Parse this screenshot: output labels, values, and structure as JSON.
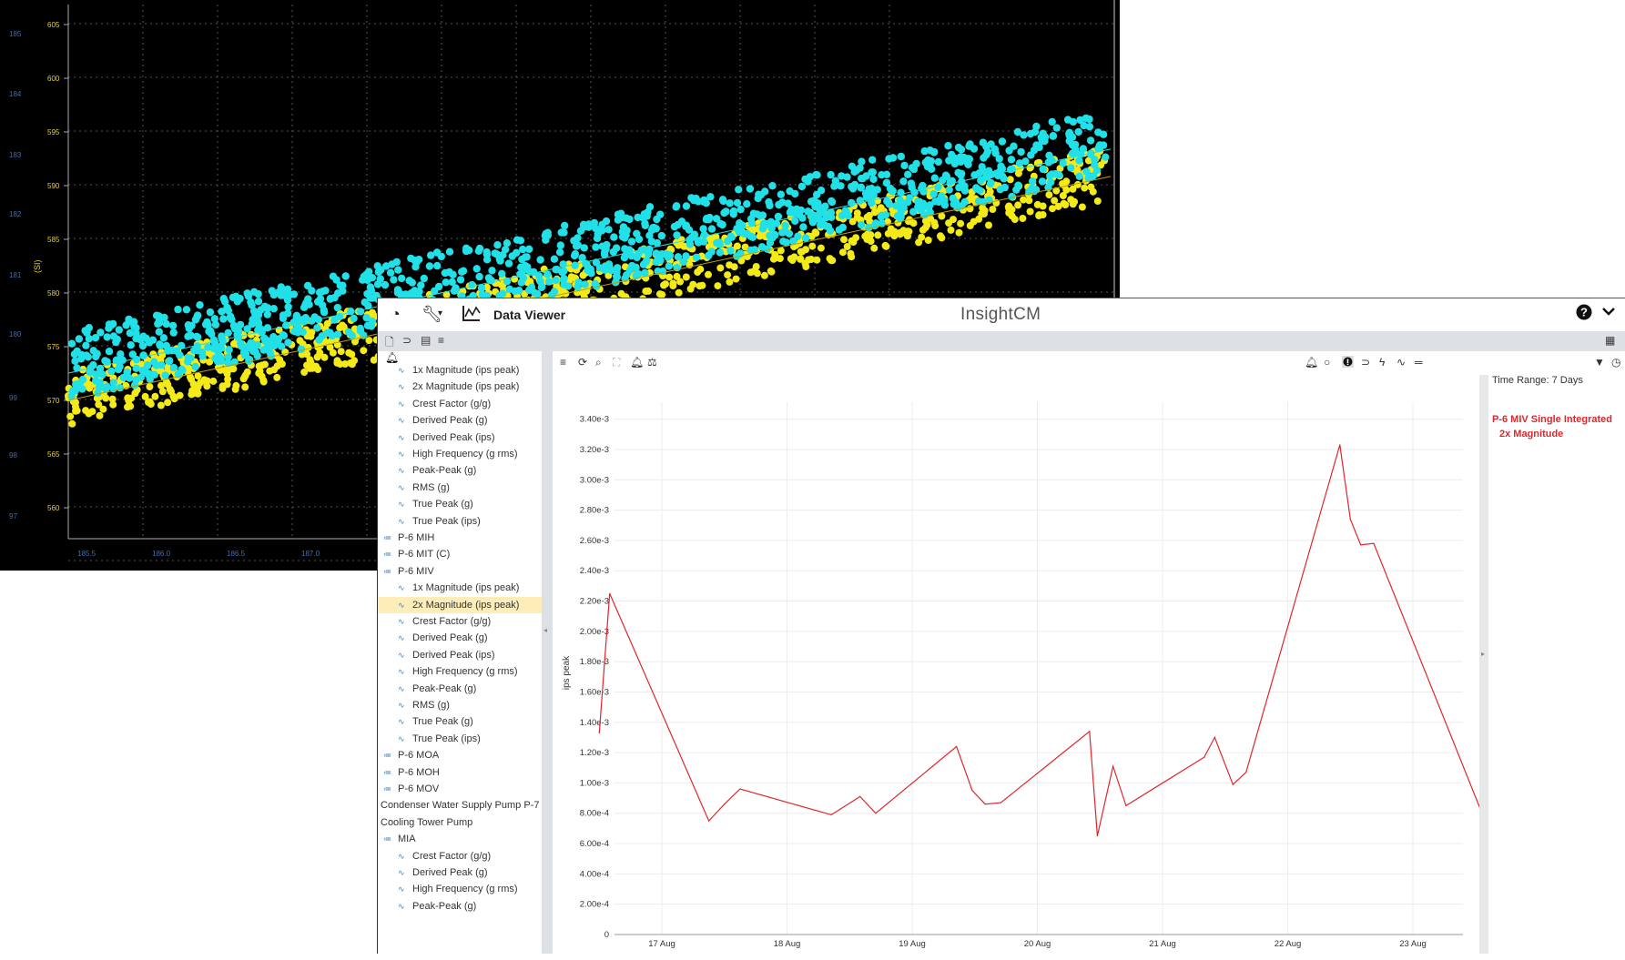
{
  "scatter_plot": {
    "y_left_ticks": [
      "185",
      "184",
      "183",
      "182",
      "181",
      "180",
      "99",
      "98",
      "97"
    ],
    "y_right_ticks": [
      "605",
      "600",
      "595",
      "590",
      "585",
      "580",
      "575",
      "570",
      "565",
      "560"
    ],
    "y_axis_label": "(SI)",
    "x_ticks": [
      "185.5",
      "186.0",
      "186.5",
      "187.0"
    ],
    "colors": {
      "series_a": "#22e0e8",
      "series_b": "#f3ea18",
      "background": "#000000",
      "grid": "#555555"
    }
  },
  "topbar": {
    "dashboard_icon": "dashboard-icon",
    "tools_icon": "wrench-icon",
    "chart_icon": "chart-icon",
    "title": "Data Viewer",
    "brand": "InsightCM",
    "help_icon": "help-icon",
    "chevron_icon": "chevron-down-icon"
  },
  "tree": {
    "items": [
      {
        "label": "1x Magnitude (ips peak)",
        "level": 2,
        "icon": "wave-icon"
      },
      {
        "label": "2x Magnitude (ips peak)",
        "level": 2,
        "icon": "wave-icon"
      },
      {
        "label": "Crest Factor (g/g)",
        "level": 2,
        "icon": "wave-icon"
      },
      {
        "label": "Derived Peak (g)",
        "level": 2,
        "icon": "wave-icon"
      },
      {
        "label": "Derived Peak (ips)",
        "level": 2,
        "icon": "wave-icon"
      },
      {
        "label": "High Frequency (g rms)",
        "level": 2,
        "icon": "wave-icon"
      },
      {
        "label": "Peak-Peak (g)",
        "level": 2,
        "icon": "wave-icon"
      },
      {
        "label": "RMS (g)",
        "level": 2,
        "icon": "wave-icon"
      },
      {
        "label": "True Peak (g)",
        "level": 2,
        "icon": "wave-icon"
      },
      {
        "label": "True Peak (ips)",
        "level": 2,
        "icon": "wave-icon"
      },
      {
        "label": "P-6 MIH",
        "level": 1,
        "icon": "sensor-icon"
      },
      {
        "label": "P-6 MIT (C)",
        "level": 1,
        "icon": "sensor-icon"
      },
      {
        "label": "P-6 MIV",
        "level": 1,
        "icon": "sensor-icon"
      },
      {
        "label": "1x Magnitude (ips peak)",
        "level": 2,
        "icon": "wave-icon"
      },
      {
        "label": "2x Magnitude (ips peak)",
        "level": 2,
        "icon": "wave-icon",
        "selected": true
      },
      {
        "label": "Crest Factor (g/g)",
        "level": 2,
        "icon": "wave-icon"
      },
      {
        "label": "Derived Peak (g)",
        "level": 2,
        "icon": "wave-icon"
      },
      {
        "label": "Derived Peak (ips)",
        "level": 2,
        "icon": "wave-icon"
      },
      {
        "label": "High Frequency (g rms)",
        "level": 2,
        "icon": "wave-icon"
      },
      {
        "label": "Peak-Peak (g)",
        "level": 2,
        "icon": "wave-icon"
      },
      {
        "label": "RMS (g)",
        "level": 2,
        "icon": "wave-icon"
      },
      {
        "label": "True Peak (g)",
        "level": 2,
        "icon": "wave-icon"
      },
      {
        "label": "True Peak (ips)",
        "level": 2,
        "icon": "wave-icon"
      },
      {
        "label": "P-6 MOA",
        "level": 1,
        "icon": "sensor-icon"
      },
      {
        "label": "P-6 MOH",
        "level": 1,
        "icon": "sensor-icon"
      },
      {
        "label": "P-6 MOV",
        "level": 1,
        "icon": "sensor-icon"
      },
      {
        "label": "Condenser Water Supply Pump P-7",
        "level": 0,
        "icon": ""
      },
      {
        "label": "Cooling Tower Pump",
        "level": 0,
        "icon": ""
      },
      {
        "label": "MIA",
        "level": 1,
        "icon": "sensor-icon"
      },
      {
        "label": "Crest Factor (g/g)",
        "level": 2,
        "icon": "wave-icon"
      },
      {
        "label": "Derived Peak (g)",
        "level": 2,
        "icon": "wave-icon"
      },
      {
        "label": "High Frequency (g rms)",
        "level": 2,
        "icon": "wave-icon"
      },
      {
        "label": "Peak-Peak (g)",
        "level": 2,
        "icon": "wave-icon"
      }
    ]
  },
  "legend_panel": {
    "time_range": "Time Range: 7 Days",
    "series_line1": "P-6 MIV Single Integrated",
    "series_line2": "2x Magnitude"
  },
  "chart_data": {
    "type": "line",
    "ylabel": "ips peak",
    "y_ticks": [
      "0",
      "2.00e-4",
      "4.00e-4",
      "6.00e-4",
      "8.00e-4",
      "1.00e-3",
      "1.20e-3",
      "1.40e-3",
      "1.60e-3",
      "1.80e-3",
      "2.00e-3",
      "2.20e-3",
      "2.40e-3",
      "2.60e-3",
      "2.80e-3",
      "3.00e-3",
      "3.20e-3",
      "3.40e-3"
    ],
    "x_ticks": [
      "17 Aug",
      "18 Aug",
      "19 Aug",
      "20 Aug",
      "21 Aug",
      "22 Aug",
      "23 Aug"
    ],
    "ylim": [
      0,
      0.0034
    ],
    "color": "#e0262b",
    "series": [
      {
        "name": "P-6 MIV Single Integrated 2x Magnitude",
        "x": [
          "16 Aug 12:00",
          "16 Aug 14:00",
          "17 Aug 9:00",
          "17 Aug 12:00",
          "17 Aug 15:00",
          "18 Aug 8:30",
          "18 Aug 14:00",
          "18 Aug 17:00",
          "19 Aug 8:30",
          "19 Aug 11:30",
          "19 Aug 14:00",
          "19 Aug 17:00",
          "20 Aug 10:00",
          "20 Aug 11:30",
          "20 Aug 14:30",
          "20 Aug 17:00",
          "21 Aug 8:00",
          "21 Aug 10:00",
          "21 Aug 13:30",
          "21 Aug 16:00",
          "22 Aug 10:00",
          "22 Aug 12:00",
          "22 Aug 14:00",
          "22 Aug 16:30",
          "23 Aug 13:30",
          "23 Aug 16:00"
        ],
        "values": [
          0.00133,
          0.00225,
          0.00075,
          0.00086,
          0.00096,
          0.00079,
          0.00091,
          0.0008,
          0.00124,
          0.00095,
          0.00086,
          0.00087,
          0.00134,
          0.00065,
          0.00111,
          0.00085,
          0.00117,
          0.0013,
          0.00099,
          0.00107,
          0.00323,
          0.00274,
          0.00257,
          0.00258,
          0.00078,
          0.00099
        ]
      }
    ]
  }
}
